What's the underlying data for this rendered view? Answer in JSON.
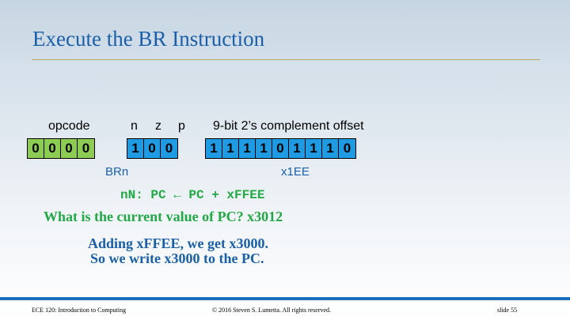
{
  "slide": {
    "title": "Execute the BR Instruction",
    "labels": {
      "opcode": "opcode",
      "n": "n",
      "z": "z",
      "p": "p",
      "offset": "9-bit 2’s complement offset"
    },
    "bits": {
      "opcode": [
        "0",
        "0",
        "0",
        "0"
      ],
      "nzp": [
        "1",
        "0",
        "0"
      ],
      "offset": [
        "1",
        "1",
        "1",
        "1",
        "0",
        "1",
        "1",
        "1",
        "0"
      ]
    },
    "sub_labels": {
      "brn": "BRn",
      "offset_hex": "x1EE"
    },
    "rtl": "nN: PC ← PC + xFFEE",
    "question": "What is the current value of PC?  x3012",
    "answer_line1": "Adding xFFEE, we get x3000.",
    "answer_line2": "So we write x3000 to the PC."
  },
  "footer": {
    "course": "ECE 120: Introduction to Computing",
    "copyright": "© 2016 Steven S. Lumetta.  All rights reserved.",
    "slide_number": "slide 55"
  },
  "colors": {
    "title": "#1a5fa8",
    "opcode_bits": "#8ccc52",
    "other_bits": "#1f9be3",
    "green_text": "#22a845",
    "footer_bar": "#1a6fb8"
  }
}
